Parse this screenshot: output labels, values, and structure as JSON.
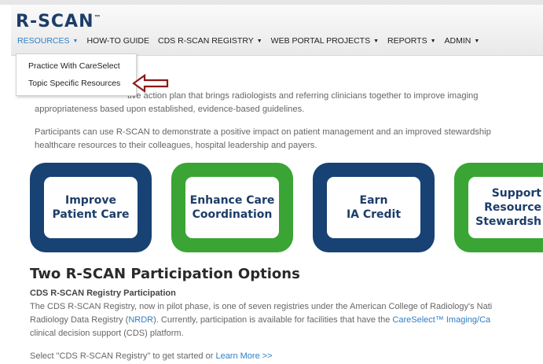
{
  "header": {
    "logo": "R-SCAN",
    "logo_mark": "™"
  },
  "nav": {
    "items": [
      {
        "label": "RESOURCES",
        "caret": "▼"
      },
      {
        "label": "HOW-TO GUIDE",
        "caret": ""
      },
      {
        "label": "CDS R-SCAN REGISTRY",
        "caret": "▼"
      },
      {
        "label": "WEB PORTAL PROJECTS",
        "caret": "▼"
      },
      {
        "label": "REPORTS",
        "caret": "▼"
      },
      {
        "label": "ADMIN",
        "caret": "▼"
      }
    ]
  },
  "dropdown": {
    "items": [
      "Practice With CareSelect",
      "Topic Specific Resources"
    ]
  },
  "intro": {
    "line1": "tive action plan that brings radiologists and referring clinicians together to improve imaging",
    "line2": "appropriateness based upon established, evidence-based guidelines.",
    "line3": "Participants can use R-SCAN to demonstrate a positive impact on patient management and an improved stewardship",
    "line4": "healthcare resources to their colleagues, hospital leadership and payers."
  },
  "tiles": [
    {
      "line1": "Improve",
      "line2": "Patient Care"
    },
    {
      "line1": "Enhance Care",
      "line2": "Coordination"
    },
    {
      "line1": "Earn",
      "line2": "IA Credit"
    },
    {
      "line1": "Support",
      "line2": "Resource",
      "line3": "Stewardsh"
    }
  ],
  "options": {
    "title": "Two R-SCAN Participation Options",
    "subtitle": "CDS R-SCAN Registry Participation",
    "line1": "The CDS R-SCAN Registry, now in pilot phase, is one of seven registries under the American College of Radiology's Nati",
    "line2_pre": "Radiology Data Registry (",
    "line2_link": "NRDR",
    "line2_mid": ").  Currently, participation is available for facilities that have the ",
    "line2_link2": "CareSelect™ Imaging/Ca",
    "line3": "clinical decision support (CDS) platform.",
    "line4_pre": "Select \"CDS R-SCAN Registry\" to get started or ",
    "line4_link": "Learn More >>"
  },
  "colors": {
    "brand_navy": "#174273",
    "brand_green": "#3aa534",
    "link_blue": "#2f7ec4",
    "arrow_red": "#8b1a1a"
  }
}
